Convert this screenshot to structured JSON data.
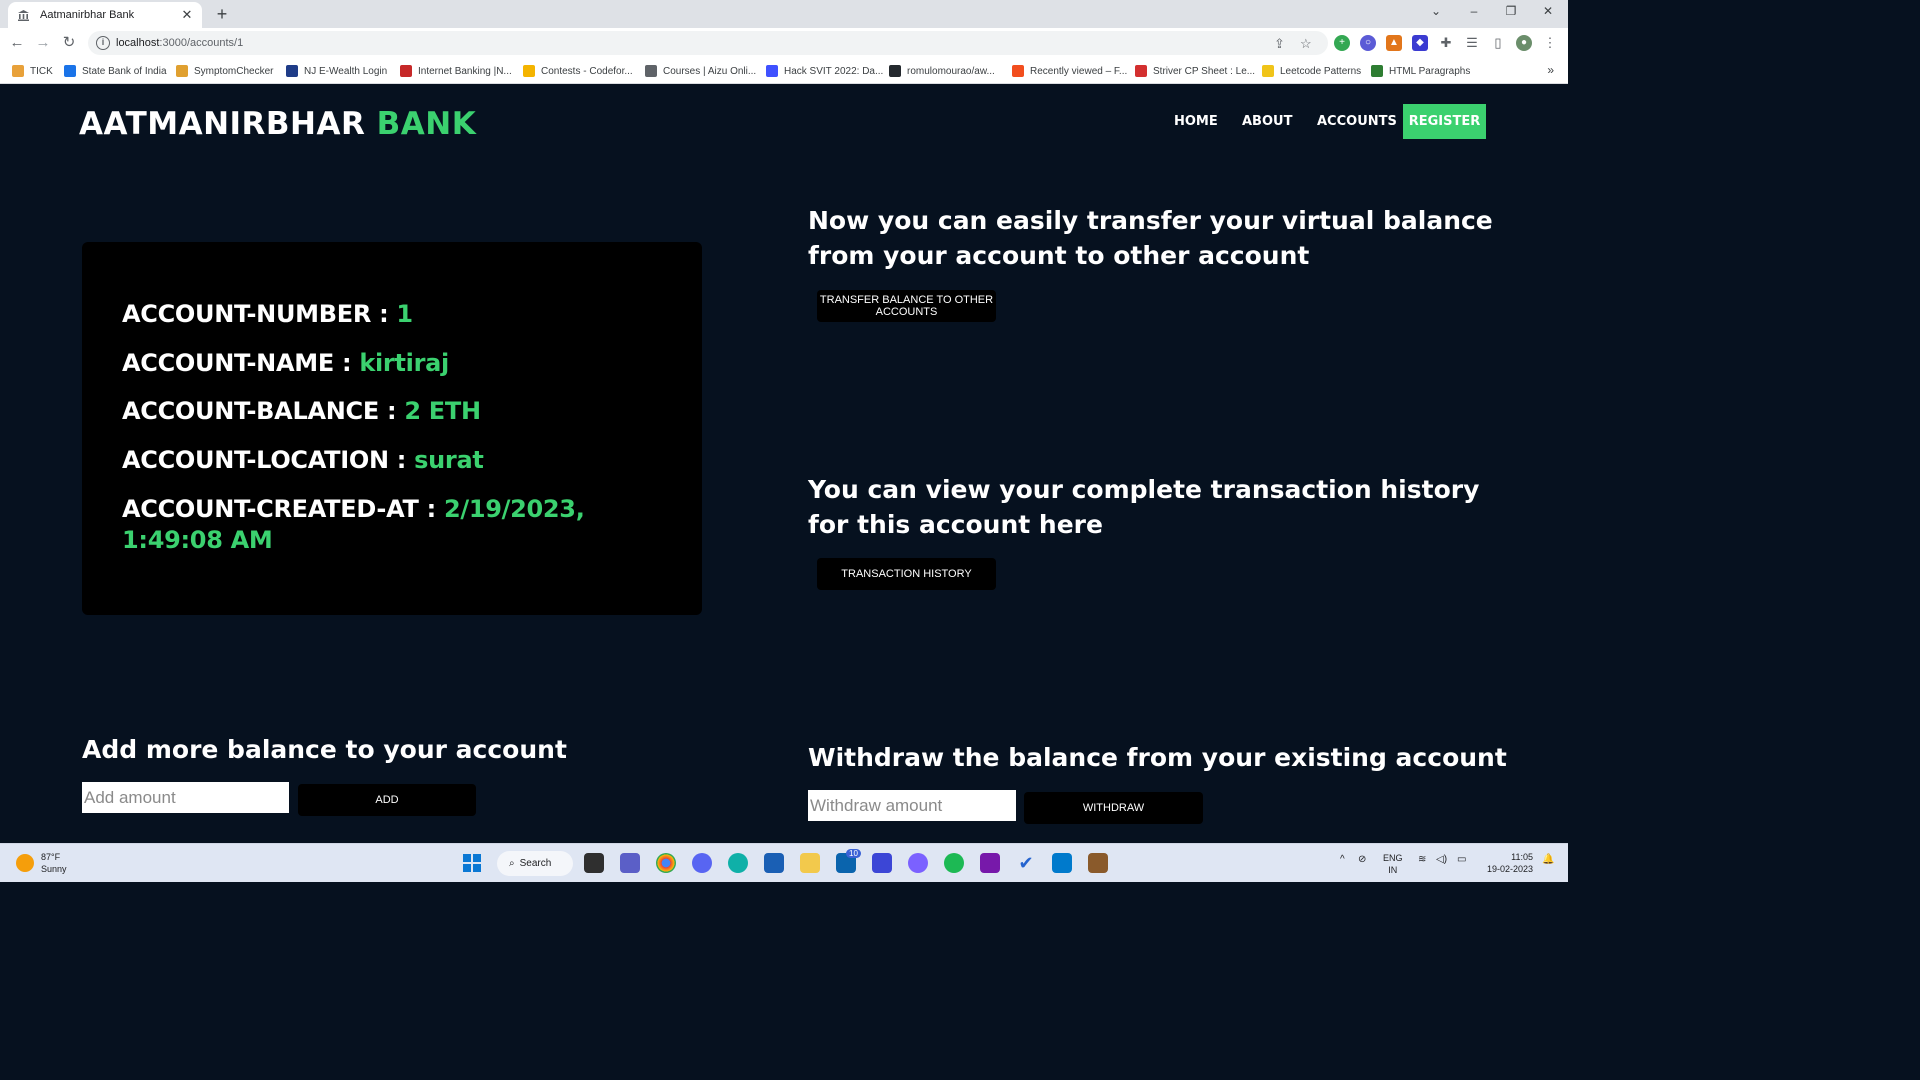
{
  "browser": {
    "tab_title": "Aatmanirbhar Bank",
    "url_host": "localhost",
    "url_path": ":3000/accounts/1",
    "bookmarks": [
      {
        "label": "TICK",
        "color": "#e8a13a"
      },
      {
        "label": "State Bank of India",
        "color": "#1a73e8"
      },
      {
        "label": "SymptomChecker",
        "color": "#e0a030"
      },
      {
        "label": "NJ E-Wealth Login",
        "color": "#1f3c88"
      },
      {
        "label": "Internet Banking |N...",
        "color": "#c62828"
      },
      {
        "label": "Contests - Codefor...",
        "color": "#f4b400"
      },
      {
        "label": "Courses | Aizu Onli...",
        "color": "#5f6368"
      },
      {
        "label": "Hack SVIT 2022: Da...",
        "color": "#3f51ff"
      },
      {
        "label": "romulomourao/aw...",
        "color": "#24292e"
      },
      {
        "label": "Recently viewed – F...",
        "color": "#f24e1e"
      },
      {
        "label": "Striver CP Sheet : Le...",
        "color": "#d32f2f"
      },
      {
        "label": "Leetcode Patterns",
        "color": "#f0c419"
      },
      {
        "label": "HTML Paragraphs",
        "color": "#2e7d32"
      }
    ]
  },
  "site": {
    "brand_main": "AATMANIRBHAR",
    "brand_accent": "BANK",
    "nav": {
      "home": "HOME",
      "about": "ABOUT",
      "accounts": "ACCOUNTS",
      "register": "REGISTER"
    }
  },
  "account": {
    "number_label": "ACCOUNT-NUMBER : ",
    "number_value": "1",
    "name_label": "ACCOUNT-NAME : ",
    "name_value": "kirtiraj",
    "balance_label": "ACCOUNT-BALANCE : ",
    "balance_value": "2 ETH",
    "location_label": "ACCOUNT-LOCATION : ",
    "location_value": "surat",
    "created_label": "ACCOUNT-CREATED-AT : ",
    "created_value": "2/19/2023, 1:49:08 AM"
  },
  "transfer": {
    "heading": "Now you can easily transfer your virtual balance from your account to other account",
    "button": "TRANSFER BALANCE TO OTHER ACCOUNTS"
  },
  "history": {
    "heading": "You can view your complete transaction history for this account here",
    "button": "TRANSACTION HISTORY"
  },
  "add": {
    "heading": "Add more balance to your account",
    "placeholder": "Add amount",
    "button": "ADD"
  },
  "withdraw": {
    "heading": "Withdraw the balance from your existing account",
    "placeholder": "Withdraw amount",
    "button": "WITHDRAW"
  },
  "taskbar": {
    "temp": "87°F",
    "weather": "Sunny",
    "search": "Search",
    "mail_badge": "10",
    "lang1": "ENG",
    "lang2": "IN",
    "time": "11:05",
    "date": "19-02-2023"
  }
}
